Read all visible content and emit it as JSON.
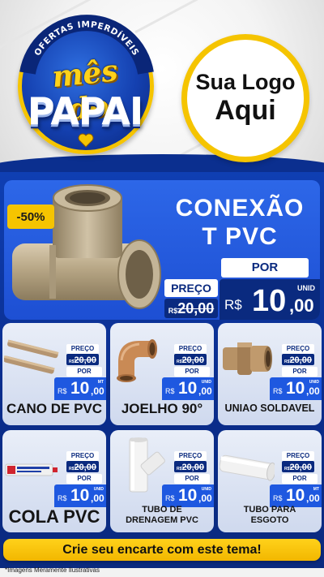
{
  "header": {
    "banner_top_text": "OFERTAS IMPERDÍVEIS",
    "banner_line1": "mês do",
    "banner_line2": "PAPAI",
    "logo_line1": "Sua Logo",
    "logo_line2": "Aqui"
  },
  "hero": {
    "discount": "-50%",
    "title_line1": "CONEXÃO",
    "title_line2": "T PVC",
    "por_label": "POR",
    "preco_label": "PREÇO",
    "old_currency": "R$",
    "old_price": "20,00",
    "unit": "UNID",
    "currency": "R$",
    "price_int": "10",
    "price_dec": ",00"
  },
  "products": [
    {
      "name": "CANO DE PVC",
      "preco_label": "PREÇO",
      "old_currency": "R$",
      "old_price": "20,00",
      "por_label": "POR",
      "unit": "MT",
      "currency": "R$",
      "price_int": "10",
      "price_dec": ",00"
    },
    {
      "name": "JOELHO 90°",
      "preco_label": "PREÇO",
      "old_currency": "R$",
      "old_price": "20,00",
      "por_label": "POR",
      "unit": "UNID",
      "currency": "R$",
      "price_int": "10",
      "price_dec": ",00"
    },
    {
      "name": "UNIAO SOLDAVEL",
      "preco_label": "PREÇO",
      "old_currency": "R$",
      "old_price": "20,00",
      "por_label": "POR",
      "unit": "UNID",
      "currency": "R$",
      "price_int": "10",
      "price_dec": ",00"
    },
    {
      "name": "COLA PVC",
      "preco_label": "PREÇO",
      "old_currency": "R$",
      "old_price": "20,00",
      "por_label": "POR",
      "unit": "UNID",
      "currency": "R$",
      "price_int": "10",
      "price_dec": ",00"
    },
    {
      "name_line1": "TUBO DE",
      "name_line2": "DRENAGEM PVC",
      "preco_label": "PREÇO",
      "old_currency": "R$",
      "old_price": "20,00",
      "por_label": "POR",
      "unit": "UNID",
      "currency": "R$",
      "price_int": "10",
      "price_dec": ",00"
    },
    {
      "name_line1": "TUBO PARA",
      "name_line2": "ESGOTO",
      "preco_label": "PREÇO",
      "old_currency": "R$",
      "old_price": "20,00",
      "por_label": "POR",
      "unit": "MT",
      "currency": "R$",
      "price_int": "10",
      "price_dec": ",00"
    }
  ],
  "cta": {
    "label": "Crie seu encarte com este tema!"
  },
  "disclaimer": "*Imagens Meramente Ilustrativas",
  "colors": {
    "brand_blue": "#0a2a7f",
    "accent_blue": "#1e58e0",
    "accent_yellow": "#f5c400"
  }
}
